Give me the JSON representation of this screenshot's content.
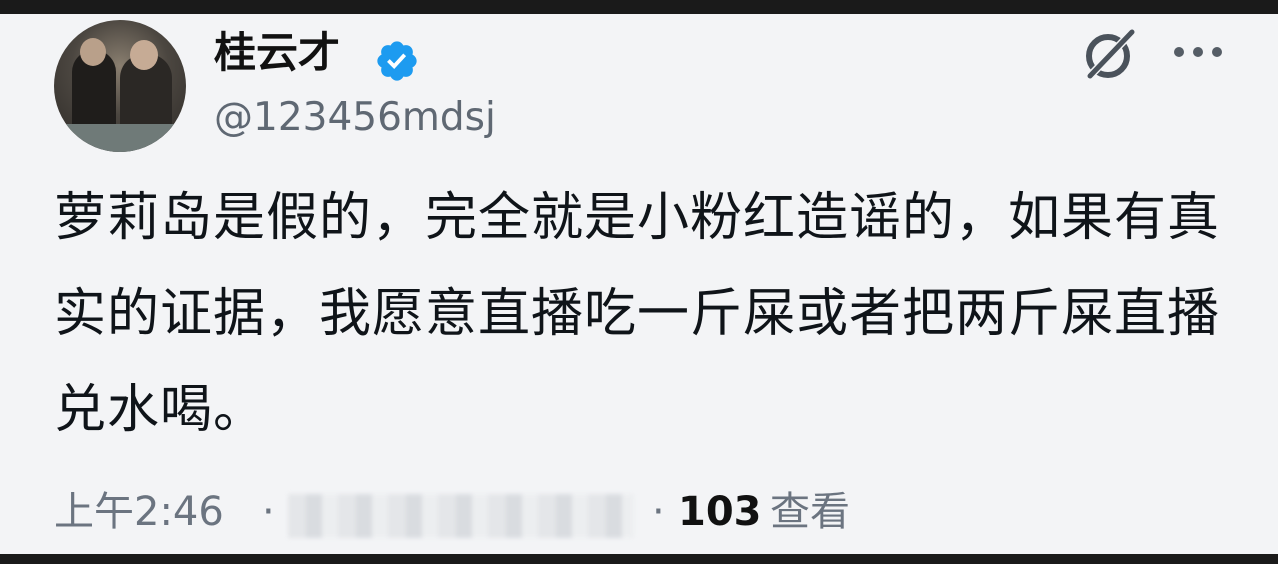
{
  "profile": {
    "display_name": "桂云才",
    "handle": "@123456mdsj",
    "verified": true
  },
  "post": {
    "text": "萝莉岛是假的，完全就是小粉红造谣的，如果有真实的证据，我愿意直播吃一斤屎或者把两斤屎直播兑水喝。",
    "time": "上午2:46",
    "separator": "·",
    "views_count": "103",
    "views_label": "查看"
  },
  "icons": {
    "verified": "verified-badge-icon",
    "grok": "grok-icon",
    "more": "more-options-icon"
  },
  "colors": {
    "verified_badge": "#1d9bf0",
    "background": "#f3f4f6",
    "text": "#0f1419",
    "muted": "#6b7480"
  }
}
